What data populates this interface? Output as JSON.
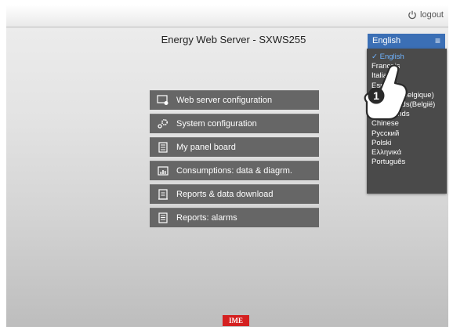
{
  "header": {
    "logout_label": "logout",
    "title": "Energy Web Server - SXWS255"
  },
  "language": {
    "selected": "English",
    "options": [
      "English",
      "Français",
      "Italiano",
      "Español",
      "Français(Belgique)",
      "Nederlands(België)",
      "Nederlands",
      "Chinese",
      "Русский",
      "Polski",
      "Ελληνικά",
      "Português"
    ],
    "selected_index": 0
  },
  "menu": {
    "items": [
      {
        "label": "Web server configuration",
        "icon": "monitor-gear-icon"
      },
      {
        "label": "System configuration",
        "icon": "gears-icon"
      },
      {
        "label": "My panel board",
        "icon": "panel-board-icon"
      },
      {
        "label": "Consumptions: data & diagrm.",
        "icon": "chart-icon"
      },
      {
        "label": "Reports & data download",
        "icon": "report-download-icon"
      },
      {
        "label": "Reports: alarms",
        "icon": "report-alarm-icon"
      }
    ]
  },
  "callout": {
    "number": "1"
  },
  "footer": {
    "logo_text": "IME"
  },
  "colors": {
    "accent": "#3b6fb5",
    "menu_bg": "#666666",
    "dropdown_bg": "#4a4a4a",
    "logo": "#d42020"
  }
}
